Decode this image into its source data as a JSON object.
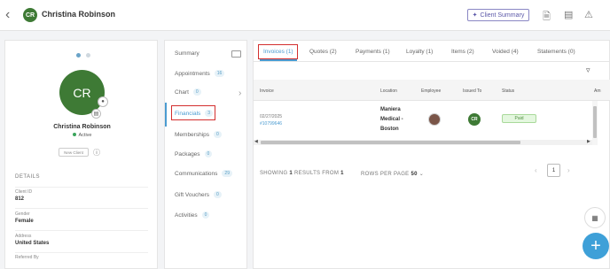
{
  "topbar": {
    "back_icon": "chevron-left-icon",
    "avatar_initials": "CR",
    "client_name": "Christina Robinson",
    "client_summary_label": "Client Summary",
    "icons": [
      "document-alert-icon",
      "notes-icon",
      "warning-icon"
    ]
  },
  "profile": {
    "initials": "CR",
    "name": "Christina Robinson",
    "status": "Active",
    "tag": "New Client",
    "details_heading": "DETAILS",
    "fields": [
      {
        "label": "Client ID",
        "value": "812"
      },
      {
        "label": "Gender",
        "value": "Female"
      },
      {
        "label": "Address",
        "value": "United States"
      },
      {
        "label": "Referred By",
        "value": ""
      }
    ]
  },
  "nav": {
    "items": [
      {
        "label": "Summary",
        "count": ""
      },
      {
        "label": "Appointments",
        "count": "16"
      },
      {
        "label": "Chart",
        "count": "0"
      },
      {
        "label": "Financials",
        "count": "3"
      },
      {
        "label": "Memberships",
        "count": "0"
      },
      {
        "label": "Packages",
        "count": "0"
      },
      {
        "label": "Communications",
        "count": "29"
      },
      {
        "label": "Gift Vouchers",
        "count": "0"
      },
      {
        "label": "Activities",
        "count": "0"
      }
    ]
  },
  "tabs": [
    "Invoices (1)",
    "Quotes (2)",
    "Payments (1)",
    "Loyalty (1)",
    "Items (2)",
    "Voided (4)",
    "Statements (0)"
  ],
  "table": {
    "headers": [
      "Invoice",
      "Location",
      "Employee",
      "Issued To",
      "Status",
      "Am"
    ],
    "row": {
      "date": "02/27/2025",
      "invoice_no": "#10799646",
      "location_lines": [
        "Maniera",
        "Medical -",
        "Boston"
      ],
      "issued_initials": "CR",
      "status": "Paid"
    }
  },
  "pagination": {
    "showing_label": "SHOWING",
    "showing_count": "1",
    "results_from_label": "RESULTS FROM",
    "results_total": "1",
    "rows_per_page_label": "ROWS PER PAGE",
    "rows_per_page_value": "50",
    "current_page": "1"
  },
  "colors": {
    "brand_green": "#3e7a35",
    "accent_blue": "#4a9bd1",
    "highlight_red": "#d32f2f",
    "paid_green": "#4f8f3f"
  }
}
